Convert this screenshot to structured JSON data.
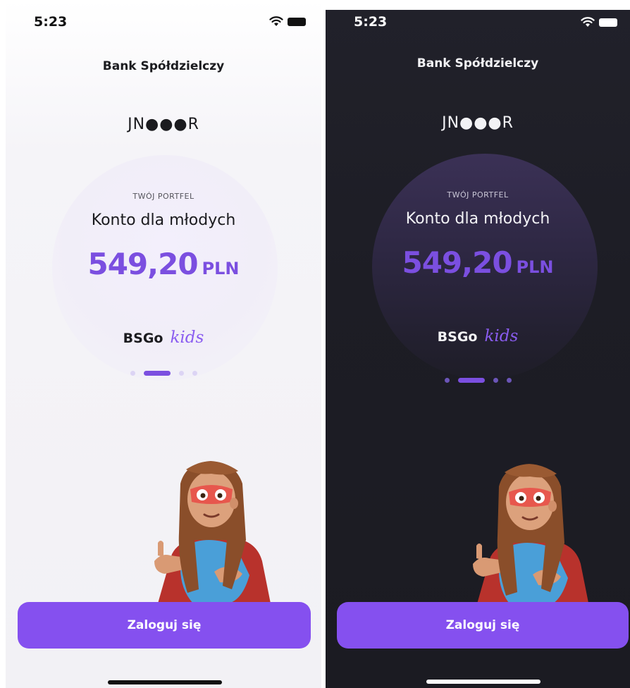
{
  "status_bar": {
    "time": "5:23",
    "wifi_icon": "wifi-icon",
    "battery_icon": "battery-icon"
  },
  "bank_name": "Bank Spółdzielczy",
  "user_initials": "JN●●●R",
  "wallet": {
    "label": "TWÓJ PORTFEL",
    "account_name": "Konto dla młodych",
    "balance_amount": "549,20",
    "balance_currency": "PLN"
  },
  "brand": {
    "main": "BSGo",
    "kids": "kids"
  },
  "carousel": {
    "pages": 4,
    "active_page": 2
  },
  "login_button_label": "Zaloguj się",
  "colors": {
    "accent": "#7b4fe0",
    "button": "#8550ef",
    "light_background": "#f2f1f5",
    "dark_background": "#1d1d25"
  }
}
